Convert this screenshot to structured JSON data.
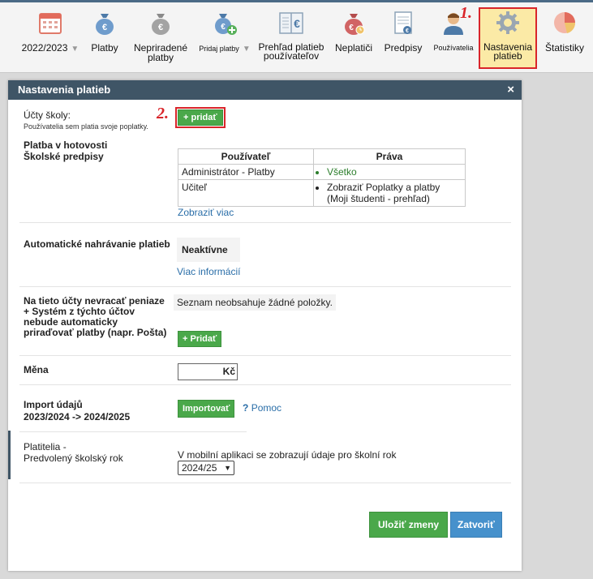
{
  "toolbar": {
    "items": [
      {
        "label": "2022/2023",
        "icon": "calendar-icon"
      },
      {
        "label": "Platby",
        "icon": "money-bag-euro-icon"
      },
      {
        "label": "Nepriradené platby",
        "icon": "money-bag-unassigned-icon"
      },
      {
        "label": "Pridaj platby",
        "icon": "money-bag-add-icon"
      },
      {
        "label": "Prehľad platieb používateľov",
        "icon": "ledger-euro-icon"
      },
      {
        "label": "Neplatiči",
        "icon": "money-bag-clock-icon"
      },
      {
        "label": "Predpisy",
        "icon": "document-euro-icon"
      },
      {
        "label": "Používatelia",
        "icon": "user-icon"
      },
      {
        "label": "Nastavenia platieb",
        "icon": "gear-icon"
      },
      {
        "label": "Štatistiky",
        "icon": "pie-chart-icon"
      }
    ],
    "step1": "1.",
    "step2": "2."
  },
  "dialog": {
    "title": "Nastavenia platieb",
    "accounts": {
      "label": "Účty školy:",
      "note": "Používatelia sem platia svoje poplatky.",
      "add_button": "+ pridať"
    },
    "cash": {
      "label_line1": "Platba v hotovosti",
      "label_line2": "Školské predpisy",
      "col_user": "Používateľ",
      "col_rights": "Práva",
      "rows": [
        {
          "user": "Administrátor - Platby",
          "rights": "Všetko"
        },
        {
          "user": "Učiteľ",
          "rights": "Zobraziť Poplatky a platby (Moji študenti - prehľad)"
        }
      ],
      "show_more": "Zobraziť viac"
    },
    "auto_upload": {
      "label": "Automatické nahrávanie platieb",
      "status": "Neaktívne",
      "more_info": "Viac informácií"
    },
    "no_return": {
      "label": "Na tieto účty nevracať peniaze + Systém z týchto účtov nebude automaticky priraďovať platby (napr. Pošta)",
      "empty_text": "Seznam neobsahuje žádné položky.",
      "add_button": "+ Pridať"
    },
    "currency": {
      "label": "Měna",
      "value": "Kč"
    },
    "import": {
      "label_line1": "Import údajů",
      "label_line2": "2023/2024 -> 2024/2025",
      "button": "Importovať",
      "help_icon": "?",
      "help": "Pomoc"
    },
    "payers": {
      "label_line1": "Platitelia -",
      "label_line2": "Predvolený školský rok",
      "description": "V mobilní aplikaci se zobrazují údaje pro školní rok",
      "selected_year": "2024/25"
    },
    "save_button": "Uložiť zmeny",
    "close_button": "Zatvoriť",
    "close_icon": "×"
  }
}
